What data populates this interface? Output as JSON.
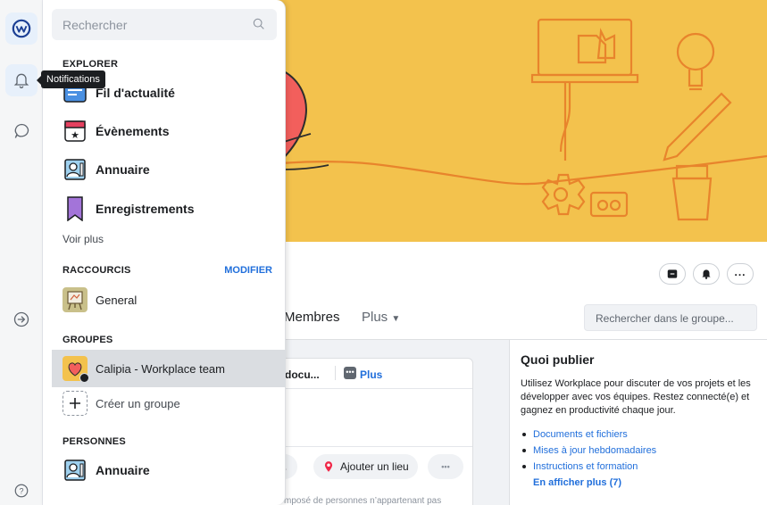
{
  "rail": {
    "tooltip": "Notifications",
    "icons": [
      "workplace-logo-icon",
      "bell-icon",
      "chat-bubble-icon",
      "arrow-right-circle-icon",
      "help-icon"
    ]
  },
  "panel": {
    "search_placeholder": "Rechercher",
    "explorer": {
      "title": "EXPLORER",
      "items": [
        {
          "label": "Fil d'actualité",
          "icon": "news-feed-icon"
        },
        {
          "label": "Évènements",
          "icon": "calendar-star-icon"
        },
        {
          "label": "Annuaire",
          "icon": "directory-icon"
        },
        {
          "label": "Enregistrements",
          "icon": "bookmark-icon"
        }
      ],
      "more": "Voir plus"
    },
    "shortcuts": {
      "title": "RACCOURCIS",
      "action": "MODIFIER",
      "items": [
        {
          "label": "General",
          "icon": "easel-icon"
        }
      ]
    },
    "groups": {
      "title": "GROUPES",
      "items": [
        {
          "label": "Calipia - Workplace team",
          "icon": "heart-group-icon",
          "selected": true
        },
        {
          "label": "Créer un groupe",
          "icon": "plus-icon"
        }
      ]
    },
    "people": {
      "title": "PERSONNES",
      "items": [
        {
          "label": "Annuaire",
          "icon": "directory-icon"
        }
      ]
    }
  },
  "group": {
    "tabs": [
      "Membres",
      "Plus"
    ],
    "search_placeholder": "Rechercher dans le groupe...",
    "composer": {
      "doc_label": "docu...",
      "plus_label": "Plus",
      "ellipsis": "...",
      "location_label": "Ajouter un lieu",
      "more_dots": "•••",
      "footer": "mposé de personnes n’appartenant pas"
    }
  },
  "side": {
    "title": "Quoi publier",
    "text": "Utilisez Workplace pour discuter de vos projets et les développer avec vos équipes. Restez connecté(e) et gagnez en productivité chaque jour.",
    "links": [
      "Documents et fichiers",
      "Mises à jour hebdomadaires",
      "Instructions et formation"
    ],
    "more": "En afficher plus (7)"
  },
  "colors": {
    "accent": "#216fdb",
    "cover": "#f3c24d",
    "heart": "#f25f5c",
    "line": "#e8842c"
  }
}
